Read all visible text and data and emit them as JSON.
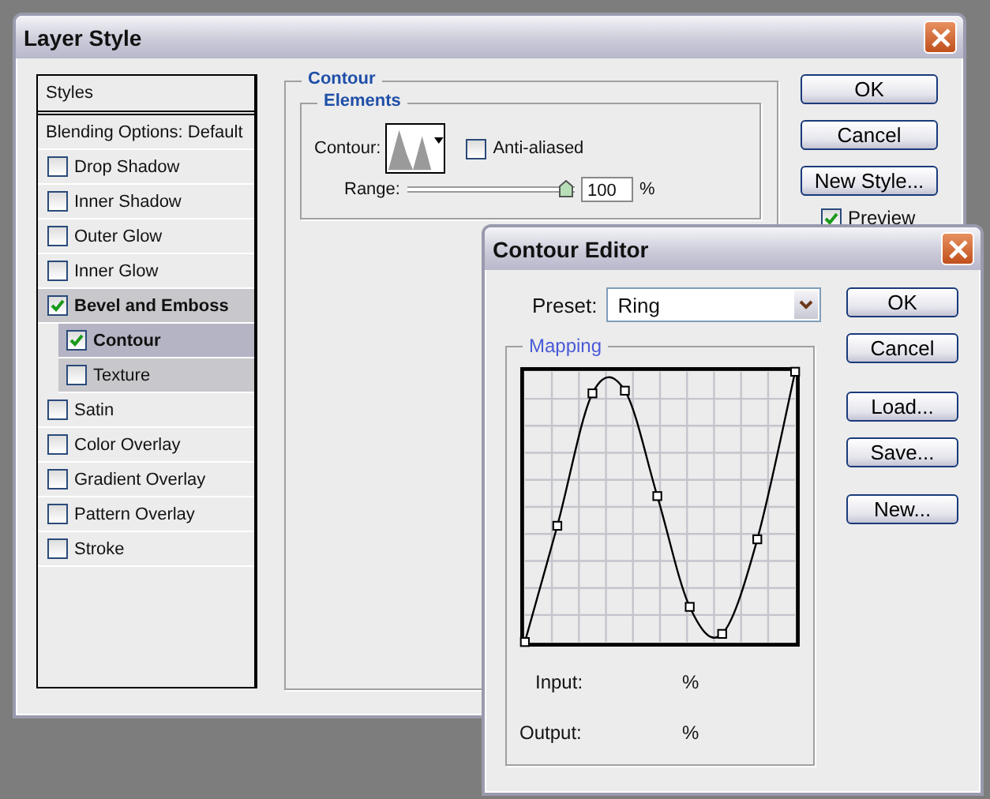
{
  "layer_style": {
    "title": "Layer Style",
    "styles_list": [
      {
        "label": "Styles",
        "kind": "header"
      },
      {
        "label": "Blending Options: Default",
        "kind": "header"
      },
      {
        "label": "Drop Shadow",
        "kind": "check",
        "checked": false,
        "selected": false
      },
      {
        "label": "Inner Shadow",
        "kind": "check",
        "checked": false,
        "selected": false
      },
      {
        "label": "Outer Glow",
        "kind": "check",
        "checked": false,
        "selected": false
      },
      {
        "label": "Inner Glow",
        "kind": "check",
        "checked": false,
        "selected": false
      },
      {
        "label": "Bevel and Emboss",
        "kind": "check",
        "checked": true,
        "selected": false,
        "children": [
          {
            "label": "Contour",
            "kind": "check",
            "checked": true,
            "selected": true
          },
          {
            "label": "Texture",
            "kind": "check",
            "checked": false,
            "selected": false
          }
        ]
      },
      {
        "label": "Satin",
        "kind": "check",
        "checked": false,
        "selected": false
      },
      {
        "label": "Color Overlay",
        "kind": "check",
        "checked": false,
        "selected": false
      },
      {
        "label": "Gradient Overlay",
        "kind": "check",
        "checked": false,
        "selected": false
      },
      {
        "label": "Pattern Overlay",
        "kind": "check",
        "checked": false,
        "selected": false
      },
      {
        "label": "Stroke",
        "kind": "check",
        "checked": false,
        "selected": false
      }
    ],
    "section_title": "Contour",
    "elements": {
      "title": "Elements",
      "contour_label": "Contour:",
      "anti_aliased": {
        "label": "Anti-aliased",
        "checked": false
      },
      "range": {
        "label": "Range:",
        "level": 1,
        "value": "100",
        "unit": "%"
      }
    },
    "buttons": [
      "OK",
      "Cancel",
      "New Style..."
    ],
    "preview": {
      "label": "Preview",
      "checked": true
    }
  },
  "contour_editor": {
    "title": "Contour Editor",
    "preset_label": "Preset:",
    "preset_value": "Ring",
    "mapping_title": "Mapping",
    "buttons": [
      "OK",
      "Cancel",
      "Load...",
      "Save...",
      "New..."
    ],
    "input_label": "Input:",
    "input_unit": "%",
    "output_label": "Output:",
    "output_unit": "%"
  }
}
